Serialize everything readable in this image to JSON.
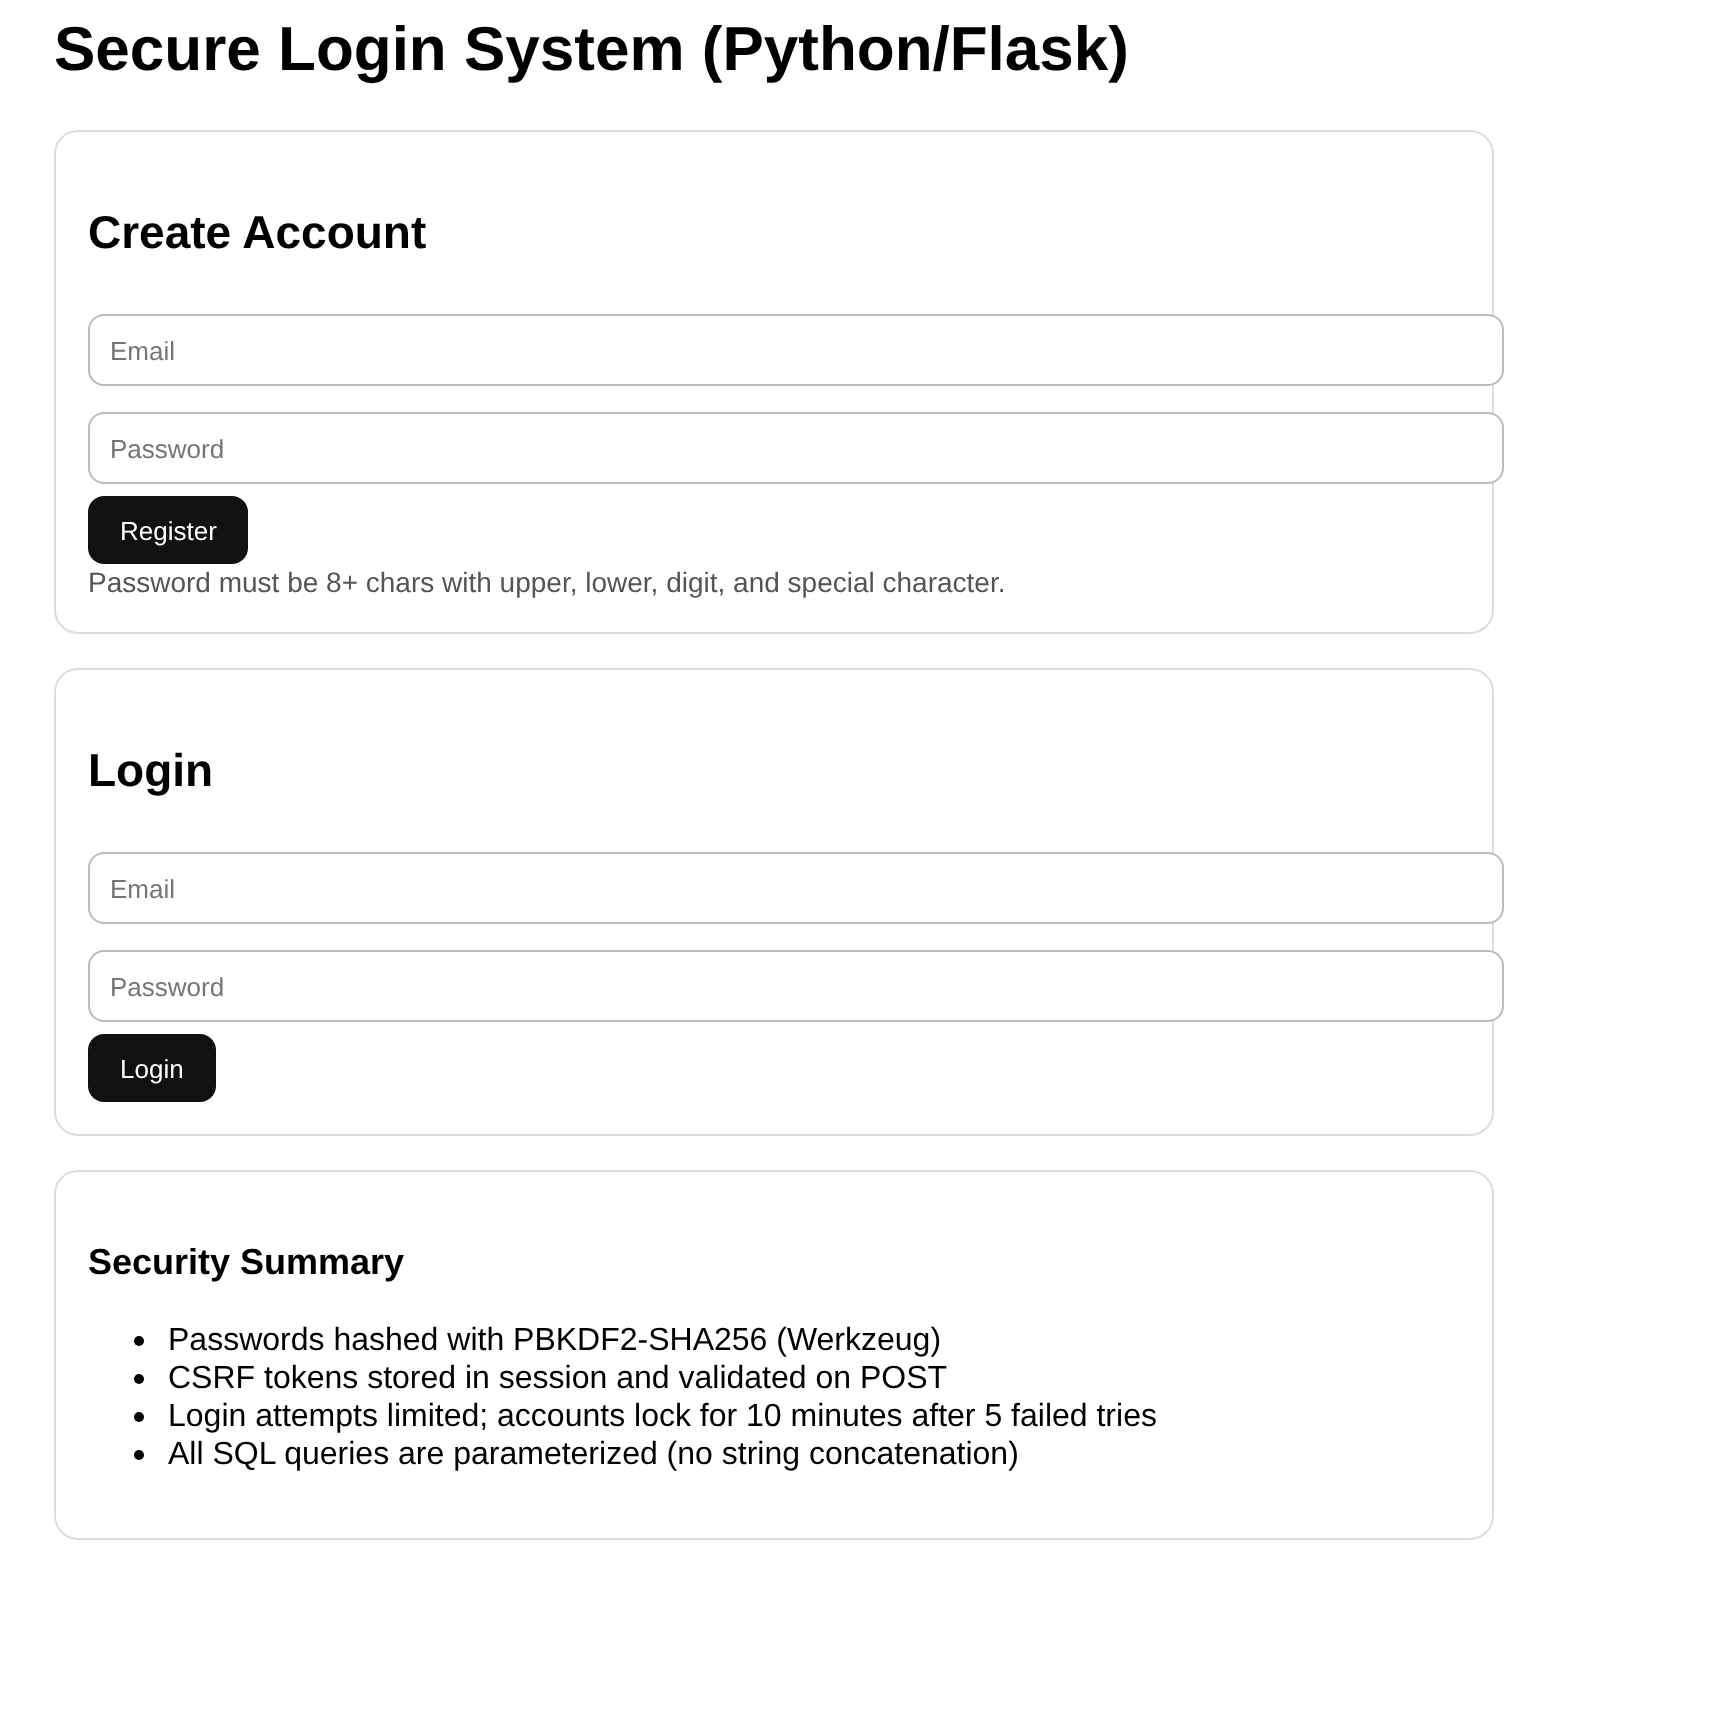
{
  "title": "Secure Login System (Python/Flask)",
  "cards": [
    {
      "kind": "form",
      "heading": "Create Account",
      "fields": [
        {
          "placeholder": "Email"
        },
        {
          "placeholder": "Password"
        }
      ],
      "button": "Register",
      "hint": "Password must be 8+ chars with upper, lower, digit, and special character."
    },
    {
      "kind": "form",
      "heading": "Login",
      "fields": [
        {
          "placeholder": "Email"
        },
        {
          "placeholder": "Password"
        }
      ],
      "button": "Login"
    },
    {
      "kind": "summary",
      "heading": "Security Summary",
      "items": [
        "Passwords hashed with PBKDF2-SHA256 (Werkzeug)",
        "CSRF tokens stored in session and validated on POST",
        "Login attempts limited; accounts lock for 10 minutes after 5 failed tries",
        "All SQL queries are parameterized (no string concatenation)"
      ]
    }
  ]
}
